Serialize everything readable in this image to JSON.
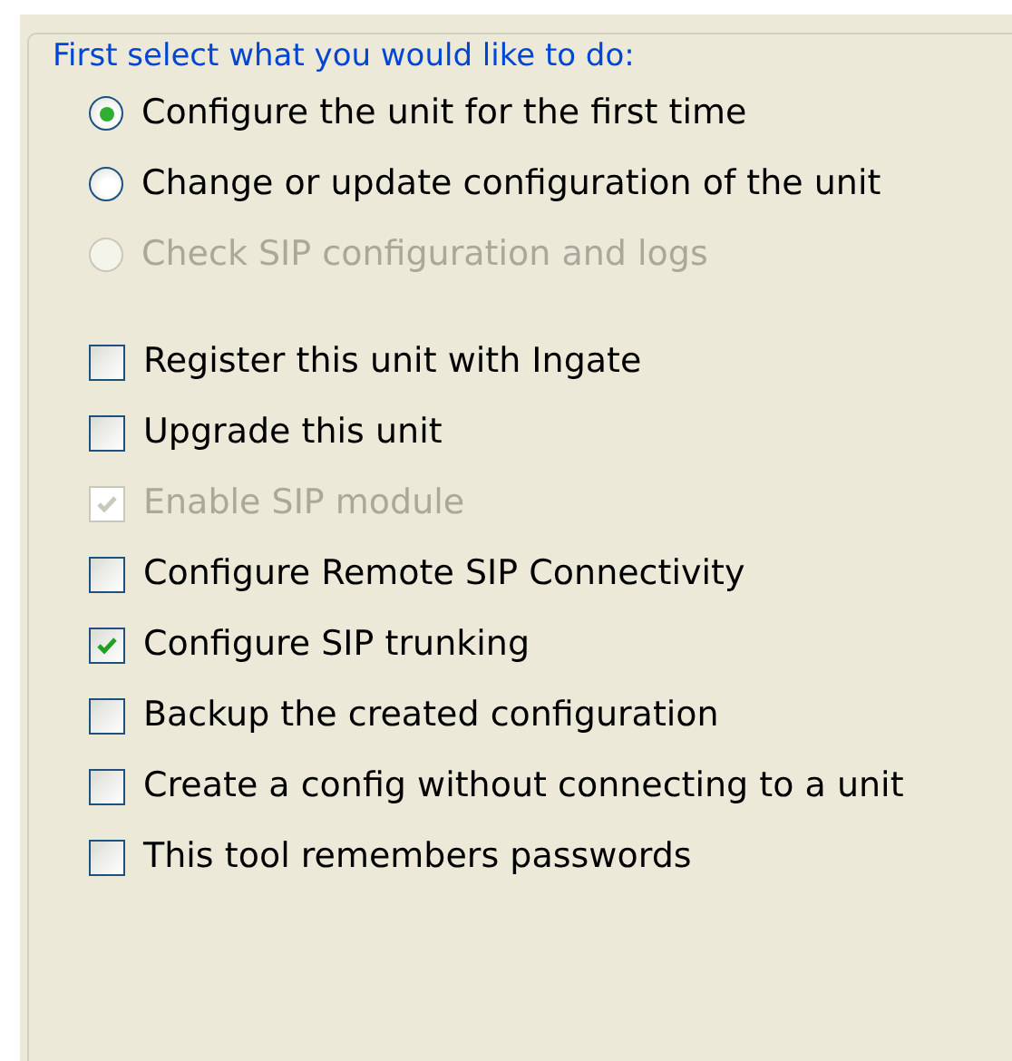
{
  "group": {
    "title": "First select what you would like to do:"
  },
  "radios": [
    {
      "label": "Configure the unit for the first time",
      "selected": true,
      "disabled": false
    },
    {
      "label": "Change or update configuration of the unit",
      "selected": false,
      "disabled": false
    },
    {
      "label": "Check SIP configuration and logs",
      "selected": false,
      "disabled": true
    }
  ],
  "checkboxes": [
    {
      "label": "Register this unit with Ingate",
      "checked": false,
      "disabled": false
    },
    {
      "label": "Upgrade this unit",
      "checked": false,
      "disabled": false
    },
    {
      "label": "Enable SIP module",
      "checked": true,
      "disabled": true
    },
    {
      "label": "Configure Remote SIP Connectivity",
      "checked": false,
      "disabled": false
    },
    {
      "label": "Configure SIP trunking",
      "checked": true,
      "disabled": false
    },
    {
      "label": "Backup the created configuration",
      "checked": false,
      "disabled": false
    },
    {
      "label": "Create a config without connecting to a unit",
      "checked": false,
      "disabled": false
    },
    {
      "label": "This tool remembers passwords",
      "checked": false,
      "disabled": false
    }
  ]
}
